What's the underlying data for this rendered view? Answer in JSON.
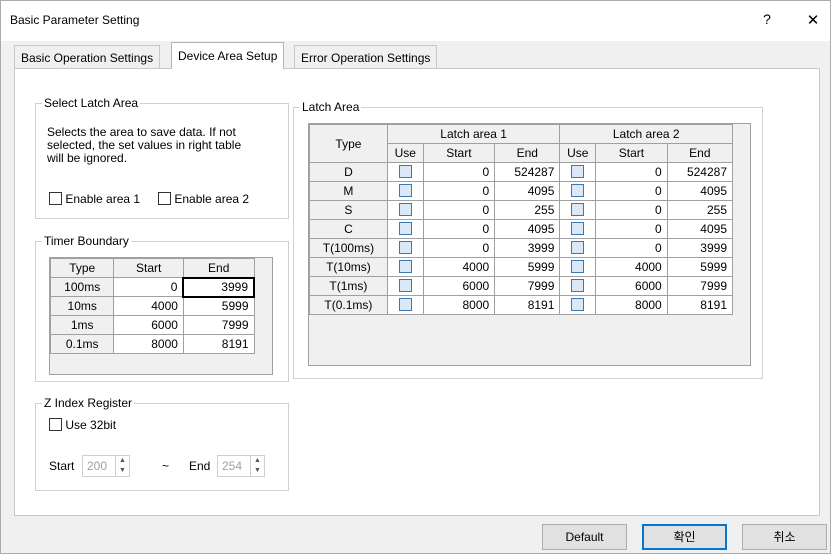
{
  "window": {
    "title": "Basic Parameter Setting",
    "help": "?",
    "close": "✕"
  },
  "tabs": [
    "Basic Operation Settings",
    "Device Area Setup",
    "Error Operation Settings"
  ],
  "select_latch": {
    "title": "Select Latch Area",
    "description_line1": "Selects the area to save data. If not",
    "description_line2": "selected, the set values in right table",
    "description_line3": "will be ignored.",
    "enable1": "Enable area 1",
    "enable2": "Enable area 2"
  },
  "timer": {
    "title": "Timer Boundary",
    "headers": [
      "Type",
      "Start",
      "End"
    ],
    "rows": [
      [
        "100ms",
        "0",
        "3999"
      ],
      [
        "10ms",
        "4000",
        "5999"
      ],
      [
        "1ms",
        "6000",
        "7999"
      ],
      [
        "0.1ms",
        "8000",
        "8191"
      ]
    ]
  },
  "zindex": {
    "title": "Z Index Register",
    "use32": "Use 32bit",
    "start_label": "Start",
    "start_value": "200",
    "tilde": "~",
    "end_label": "End",
    "end_value": "254"
  },
  "latch": {
    "title": "Latch Area",
    "type_header": "Type",
    "area1": "Latch area 1",
    "area2": "Latch area 2",
    "sub_headers": [
      "Use",
      "Start",
      "End",
      "Use",
      "Start",
      "End"
    ],
    "rows": [
      [
        "D",
        "0",
        "524287",
        "0",
        "524287"
      ],
      [
        "M",
        "0",
        "4095",
        "0",
        "4095"
      ],
      [
        "S",
        "0",
        "255",
        "0",
        "255"
      ],
      [
        "C",
        "0",
        "4095",
        "0",
        "4095"
      ],
      [
        "T(100ms)",
        "0",
        "3999",
        "0",
        "3999"
      ],
      [
        "T(10ms)",
        "4000",
        "5999",
        "4000",
        "5999"
      ],
      [
        "T(1ms)",
        "6000",
        "7999",
        "6000",
        "7999"
      ],
      [
        "T(0.1ms)",
        "8000",
        "8191",
        "8000",
        "8191"
      ]
    ]
  },
  "buttons": {
    "default": "Default",
    "ok": "확인",
    "cancel": "취소"
  }
}
